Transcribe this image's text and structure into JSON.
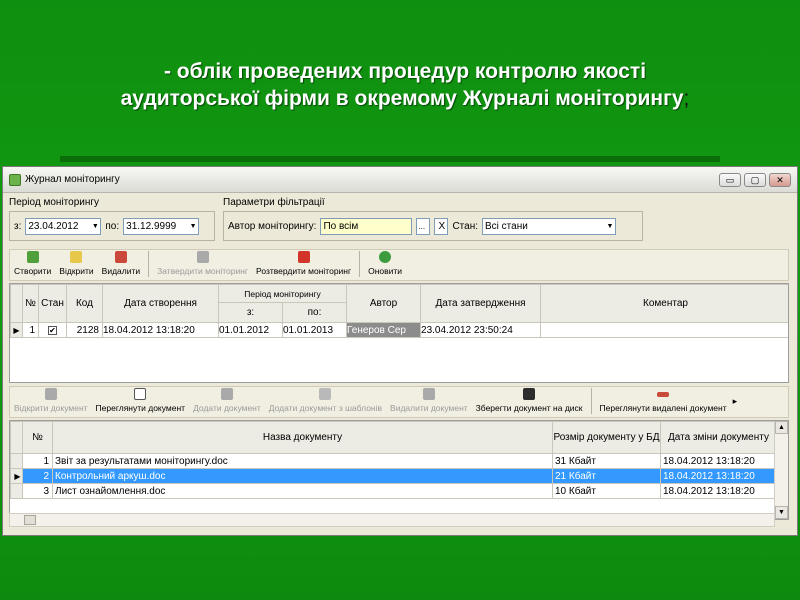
{
  "slide": {
    "heading_line1": "- облік проведених процедур контролю якості",
    "heading_line2": "аудиторської фірми в окремому Журналі моніторингу",
    "heading_semicolon": ";"
  },
  "window": {
    "title": "Журнал моніторингу",
    "controls": {
      "minimize": "▭",
      "maximize": "▢",
      "close": "✕"
    }
  },
  "filters": {
    "period_label": "Період моніторингу",
    "from_label": "з:",
    "from_value": "23.04.2012",
    "to_label": "по:",
    "to_value": "31.12.9999",
    "params_label": "Параметри фільтрації",
    "author_label": "Автор моніторингу:",
    "author_value": "По всім",
    "author_dots": "...",
    "author_clear": "X",
    "state_label": "Стан:",
    "state_value": "Всі стани"
  },
  "toolbar1": {
    "create": "Створити",
    "open": "Відкрити",
    "delete": "Видалити",
    "approve": "Затвердити моніторинг",
    "unapprove": "Розтвердити моніторинг",
    "refresh": "Оновити"
  },
  "grid1": {
    "headers": {
      "no": "№",
      "state": "Стан",
      "code": "Код",
      "created": "Дата створення",
      "period": "Період моніторингу",
      "from": "з:",
      "to": "по:",
      "author": "Автор",
      "approved": "Дата затвердження",
      "comment": "Коментар"
    },
    "rows": [
      {
        "no": "1",
        "state": "✔",
        "code": "2128",
        "created": "18.04.2012 13:18:20",
        "from": "01.01.2012",
        "to": "01.01.2013",
        "author": "Генеров Сер",
        "approved": "23.04.2012 23:50:24",
        "comment": ""
      }
    ]
  },
  "toolbar2": {
    "open_doc": "Відкрити документ",
    "view_doc": "Переглянути документ",
    "add_doc": "Додати документ",
    "add_from_template": "Додати документ з шаблонів",
    "delete_doc": "Видалити документ",
    "save_to_disk": "Зберегти документ на диск",
    "view_deleted": "Переглянути видалені документ",
    "more": "▸"
  },
  "grid2": {
    "headers": {
      "no": "№",
      "name": "Назва документу",
      "size": "Розмір документу у БД",
      "changed": "Дата зміни документу"
    },
    "rows": [
      {
        "no": "1",
        "name": "Звіт за результатами моніторингу.doc",
        "size": "31 Кбайт",
        "changed": "18.04.2012 13:18:20"
      },
      {
        "no": "2",
        "name": "Контрольний аркуш.doc",
        "size": "21 Кбайт",
        "changed": "18.04.2012 13:18:20"
      },
      {
        "no": "3",
        "name": "Лист ознайомлення.doc",
        "size": "10 Кбайт",
        "changed": "18.04.2012 13:18:20"
      }
    ]
  },
  "colors": {
    "background": "#119c11",
    "selection": "#3399ff",
    "window": "#ece9d8"
  }
}
